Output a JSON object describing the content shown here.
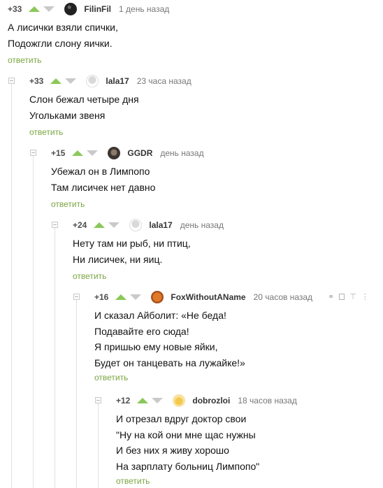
{
  "comments": [
    {
      "rating": "+33",
      "nick": "FilinFil",
      "time": "1 день назад",
      "lines": [
        "А лисички взяли спички,",
        "Подожгли слону яички."
      ],
      "reply": "ответить"
    },
    {
      "rating": "+33",
      "nick": "lala17",
      "time": "23 часа назад",
      "lines": [
        "Слон бежал четыре дня",
        "Угольками звеня"
      ],
      "reply": "ответить"
    },
    {
      "rating": "+15",
      "nick": "GGDR",
      "time": "день назад",
      "lines": [
        "Убежал он в Лимпопо",
        "Там лисичек нет давно"
      ],
      "reply": "ответить"
    },
    {
      "rating": "+24",
      "nick": "lala17",
      "time": "день назад",
      "lines": [
        "Нету там ни рыб, ни птиц,",
        "Ни лисичек, ни яиц."
      ],
      "reply": "ответить"
    },
    {
      "rating": "+16",
      "nick": "FoxWithoutAName",
      "time": "20 часов назад",
      "lines": [
        "И сказал Айболит: «Не беда!",
        "Подавайте его сюда!",
        "Я пришью ему новые яйки,",
        "Будет он танцевать на лужайке!»"
      ],
      "reply": "ответить"
    },
    {
      "rating": "+12",
      "nick": "dobrozloi",
      "time": "18 часов назад",
      "lines": [
        "И отрезал вдруг доктор свои",
        "\"Ну на кой они мне щас нужны",
        "И без них я живу хорошо",
        "На зарплату больниц Лимпопо\""
      ],
      "reply": "ответить"
    }
  ],
  "colors": {
    "accent": "#7aa641",
    "vote_up": "#8ac858",
    "vote_down": "#c9c9c9"
  }
}
